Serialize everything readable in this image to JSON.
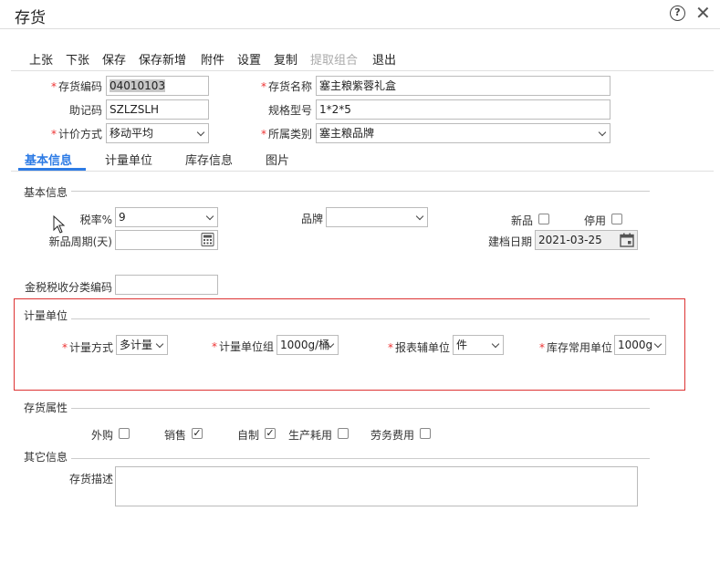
{
  "window": {
    "title": "存货"
  },
  "toolbar": [
    "上张",
    "下张",
    "保存",
    "保存新增",
    "附件",
    "设置",
    "复制",
    "提取组合",
    "退出"
  ],
  "header_form": {
    "code_label": "存货编码",
    "code_value": "04010103",
    "name_label": "存货名称",
    "name_value": "塞主粮紫蓉礼盒",
    "mnemonic_label": "助记码",
    "mnemonic_value": "SZLZSLH",
    "spec_label": "规格型号",
    "spec_value": "1*2*5",
    "pricing_label": "计价方式",
    "pricing_value": "移动平均",
    "category_label": "所属类别",
    "category_value": "塞主粮品牌"
  },
  "tabs": [
    "基本信息",
    "计量单位",
    "库存信息",
    "图片"
  ],
  "basic": {
    "section_title": "基本信息",
    "tax_label": "税率%",
    "tax_value": "9",
    "brand_label": "品牌",
    "brand_value": "",
    "new_label": "新品",
    "new_checked": false,
    "disabled_label": "停用",
    "disabled_checked": false,
    "new_period_label": "新品周期(天)",
    "new_period_value": "",
    "created_label": "建档日期",
    "created_value": "2021-03-25",
    "tax_code_label": "金税税收分类编码",
    "tax_code_value": ""
  },
  "unit": {
    "section_title": "计量单位",
    "method_label": "计量方式",
    "method_value": "多计量",
    "group_label": "计量单位组",
    "group_value": "1000g/桶",
    "report_label": "报表辅单位",
    "report_value": "件",
    "stock_label": "库存常用单位",
    "stock_value": "1000g"
  },
  "attributes": {
    "section_title": "存货属性",
    "items": [
      {
        "label": "外购",
        "checked": false
      },
      {
        "label": "销售",
        "checked": true
      },
      {
        "label": "自制",
        "checked": true
      },
      {
        "label": "生产耗用",
        "checked": false
      },
      {
        "label": "劳务费用",
        "checked": false
      }
    ]
  },
  "other": {
    "section_title": "其它信息",
    "desc_label": "存货描述",
    "desc_value": ""
  },
  "colors": {
    "accent": "#2d7be5",
    "required": "#e33",
    "frame": "#d33"
  }
}
